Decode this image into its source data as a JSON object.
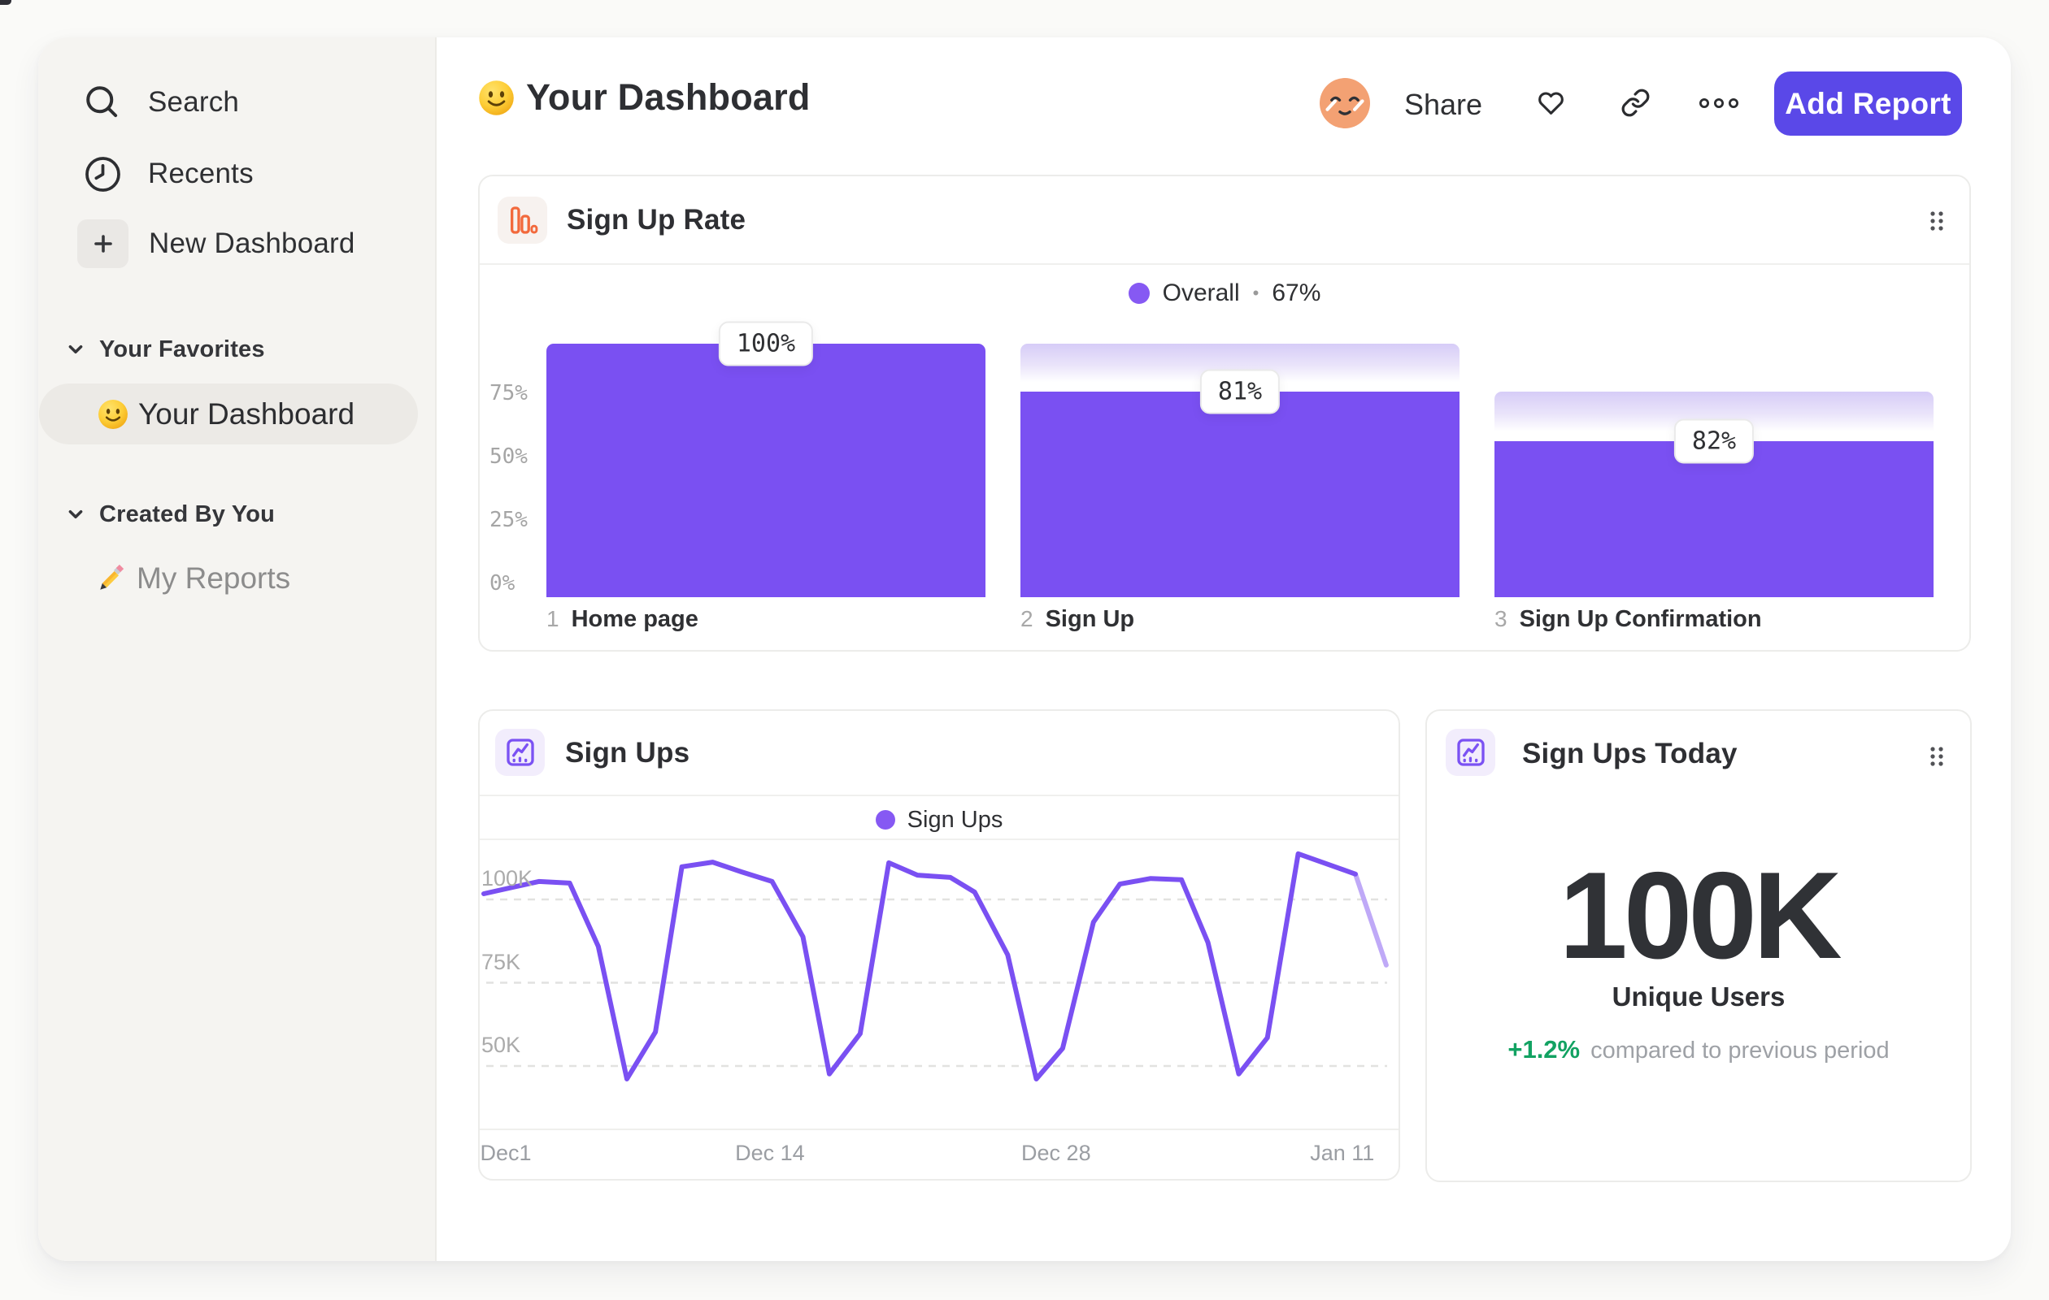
{
  "colors": {
    "accent_purple": "#7A50F2",
    "legend_dot_purple": "#8659F3",
    "partial_line_purple": "#BFA9F7",
    "button_indigo": "#5A48E8",
    "positive_green": "#12A262",
    "icon_orange": "#F2693C"
  },
  "sidebar": {
    "nav": [
      {
        "label": "Search"
      },
      {
        "label": "Recents"
      },
      {
        "label": "New Dashboard"
      }
    ],
    "sections": [
      {
        "label": "Your Favorites",
        "items": [
          {
            "label": "Your Dashboard",
            "active": true
          }
        ]
      },
      {
        "label": "Created By You",
        "items": [
          {
            "label": "My Reports",
            "active": false
          }
        ]
      }
    ]
  },
  "header": {
    "title": "Your Dashboard",
    "share_label": "Share",
    "add_report_label": "Add Report"
  },
  "chart_data": [
    {
      "type": "bar",
      "variant": "funnel",
      "title": "Sign Up Rate",
      "legend": {
        "series": "Overall",
        "separator": "•",
        "overall_value": "67%"
      },
      "overall_conversion_pct": 67,
      "steps": [
        {
          "step": "1",
          "name": "Home page",
          "conversion_from_previous_pct": 100,
          "pct_of_first": 100
        },
        {
          "step": "2",
          "name": "Sign Up",
          "conversion_from_previous_pct": 81,
          "pct_of_first": 81
        },
        {
          "step": "3",
          "name": "Sign Up Confirmation",
          "conversion_from_previous_pct": 82,
          "pct_of_first": 61.5
        }
      ],
      "yticks": [
        {
          "label": "75%",
          "value": 75
        },
        {
          "label": "50%",
          "value": 50
        },
        {
          "label": "25%",
          "value": 25
        },
        {
          "label": "0%",
          "value": 0
        }
      ],
      "ylim": [
        0,
        100
      ],
      "grid": false,
      "legend_position": "top-center"
    },
    {
      "type": "line",
      "title": "Sign Ups",
      "legend": {
        "series": "Sign Ups"
      },
      "xlabel": "",
      "ylabel": "",
      "yticks": [
        {
          "label": "100K",
          "value": 100
        },
        {
          "label": "75K",
          "value": 75
        },
        {
          "label": "50K",
          "value": 50
        }
      ],
      "xticks": [
        {
          "label": "Dec1",
          "day": 1
        },
        {
          "label": "Dec 14",
          "day": 13
        },
        {
          "label": "Dec 28",
          "day": 26
        },
        {
          "label": "Jan 11",
          "day": 39
        }
      ],
      "x_range_days": [
        0,
        41
      ],
      "grid": "dashed-horizontal",
      "legend_position": "top-center",
      "points_day_valueK": [
        [
          0,
          101.7
        ],
        [
          2.5,
          105.4
        ],
        [
          3.9,
          104.9
        ],
        [
          5.2,
          85.9
        ],
        [
          6.5,
          46.1
        ],
        [
          7.8,
          60.2
        ],
        [
          9.0,
          109.8
        ],
        [
          10.4,
          111.2
        ],
        [
          11.7,
          108.3
        ],
        [
          13.1,
          105.4
        ],
        [
          14.5,
          88.8
        ],
        [
          15.7,
          47.6
        ],
        [
          17.1,
          59.7
        ],
        [
          18.4,
          111.0
        ],
        [
          19.7,
          107.3
        ],
        [
          21.2,
          106.6
        ],
        [
          22.3,
          102.2
        ],
        [
          23.8,
          83.4
        ],
        [
          25.1,
          46.1
        ],
        [
          26.3,
          55.3
        ],
        [
          27.7,
          93.2
        ],
        [
          28.9,
          104.6
        ],
        [
          30.3,
          106.3
        ],
        [
          31.7,
          105.9
        ],
        [
          32.9,
          87.1
        ],
        [
          34.3,
          47.6
        ],
        [
          35.6,
          58.5
        ],
        [
          37.0,
          113.7
        ],
        [
          39.6,
          107.6
        ],
        [
          41.0,
          80.3
        ]
      ],
      "partial_segment_start_index": 28
    },
    {
      "type": "number",
      "title": "Sign Ups Today",
      "value": "100K",
      "value_label": "Unique Users",
      "delta": "+1.2%",
      "delta_note": "compared to previous period"
    }
  ]
}
